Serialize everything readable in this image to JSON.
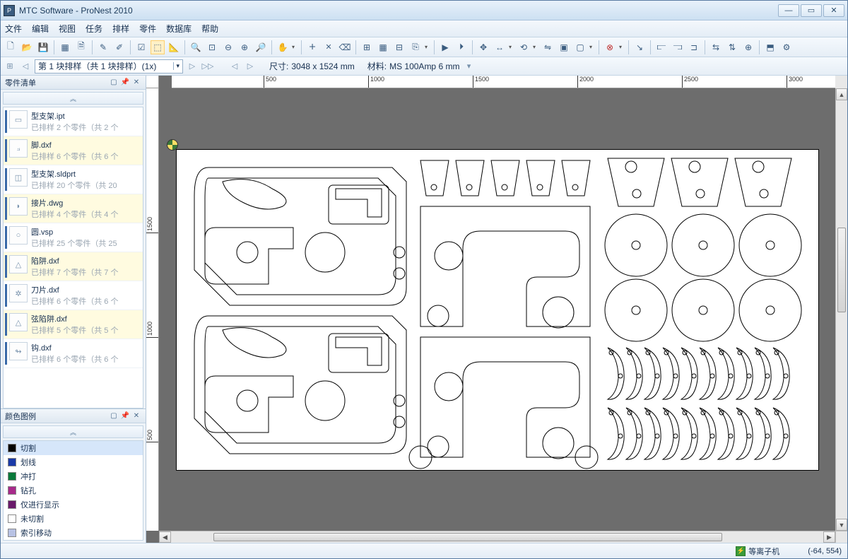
{
  "window": {
    "title": "MTC Software - ProNest 2010"
  },
  "menu": [
    "文件",
    "编辑",
    "视图",
    "任务",
    "排样",
    "零件",
    "数据库",
    "帮助"
  ],
  "nav": {
    "combo": "第 1 块排样（共 1 块排样）(1x)",
    "size_label": "尺寸:",
    "size_value": "3048 x 1524 mm",
    "material_label": "材料:",
    "material_value": "MS 100Amp 6 mm"
  },
  "panels": {
    "parts_title": "零件清单",
    "legend_title": "颜色图例"
  },
  "parts": [
    {
      "name": "型支架.ipt",
      "sub": "已排样 2 个零件（共 2 个",
      "sel": false,
      "icon": "▭"
    },
    {
      "name": "脚.dxf",
      "sub": "已排样 6 个零件（共 6 个",
      "sel": true,
      "icon": "⟓"
    },
    {
      "name": "型支架.sldprt",
      "sub": "已排样 20 个零件（共 20",
      "sel": false,
      "icon": "◫"
    },
    {
      "name": "接片.dwg",
      "sub": "已排样 4 个零件（共 4 个",
      "sel": true,
      "icon": "◗"
    },
    {
      "name": "圆.vsp",
      "sub": "已排样 25 个零件（共 25",
      "sel": false,
      "icon": "○"
    },
    {
      "name": "陷阱.dxf",
      "sub": "已排样 7 个零件（共 7 个",
      "sel": true,
      "icon": "△"
    },
    {
      "name": "刀片.dxf",
      "sub": "已排样 6 个零件（共 6 个",
      "sel": false,
      "icon": "✲"
    },
    {
      "name": "弦陷阱.dxf",
      "sub": "已排样 5 个零件（共 5 个",
      "sel": true,
      "icon": "△"
    },
    {
      "name": "钩.dxf",
      "sub": "已排样 6 个零件（共 6 个",
      "sel": false,
      "icon": "↬"
    }
  ],
  "legend": [
    {
      "label": "切割",
      "color": "#000000",
      "sel": true
    },
    {
      "label": "划线",
      "color": "#1a3aa8",
      "sel": false
    },
    {
      "label": "冲打",
      "color": "#0a7a3a",
      "sel": false
    },
    {
      "label": "钻孔",
      "color": "#a82a8a",
      "sel": false
    },
    {
      "label": "仅进行显示",
      "color": "#6a1a6a",
      "sel": false
    },
    {
      "label": "未切割",
      "color": "#ffffff",
      "sel": false
    },
    {
      "label": "索引移动",
      "color": "#b8c2e4",
      "sel": false
    }
  ],
  "ruler_h": [
    "500",
    "1000",
    "1500",
    "2000",
    "2500",
    "3000"
  ],
  "ruler_v": [
    "500",
    "1000",
    "1500"
  ],
  "status": {
    "mode": "等离子机",
    "coords": "(-64, 554)"
  }
}
